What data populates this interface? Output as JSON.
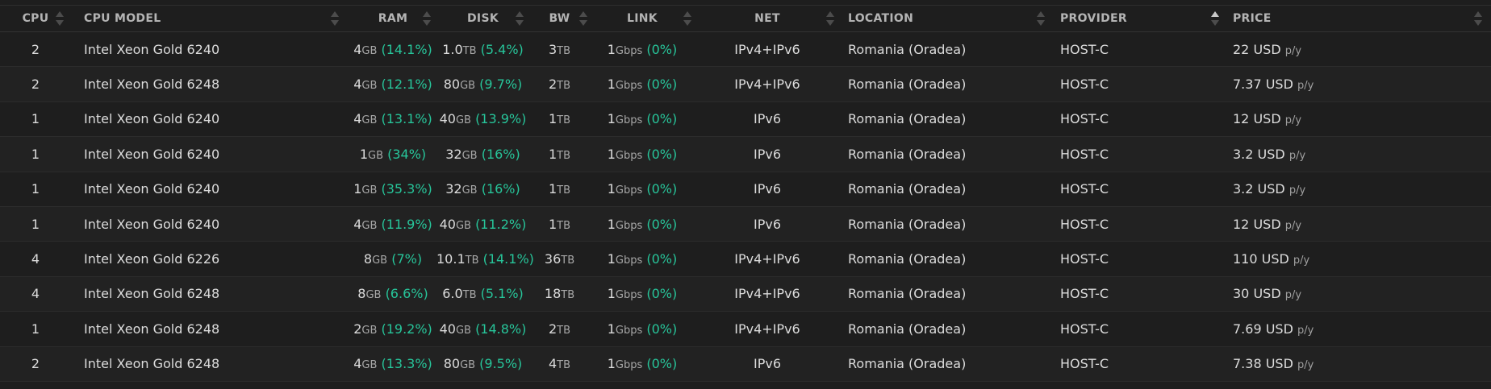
{
  "headers": {
    "cpu": "CPU",
    "cpu_model": "CPU MODEL",
    "ram": "RAM",
    "disk": "DISK",
    "bw": "BW",
    "link": "LINK",
    "net": "NET",
    "location": "LOCATION",
    "provider": "PROVIDER",
    "price": "PRICE"
  },
  "sorted_column": "provider",
  "colors": {
    "percent": "#27c59a",
    "background": "#1e1e1e",
    "alt_row": "#222222"
  },
  "rows": [
    {
      "cpu": "2",
      "model": "Intel Xeon Gold 6240",
      "ram": "4",
      "ram_unit": "GB",
      "ram_pct": "(14.1%)",
      "disk": "1.0",
      "disk_unit": "TB",
      "disk_pct": "(5.4%)",
      "bw": "3",
      "bw_unit": "TB",
      "link": "1",
      "link_unit": "Gbps",
      "link_pct": "(0%)",
      "net": "IPv4+IPv6",
      "location": "Romania (Oradea)",
      "provider": "HOST-C",
      "price": "22 USD",
      "price_unit": "p/y"
    },
    {
      "cpu": "2",
      "model": "Intel Xeon Gold 6248",
      "ram": "4",
      "ram_unit": "GB",
      "ram_pct": "(12.1%)",
      "disk": "80",
      "disk_unit": "GB",
      "disk_pct": "(9.7%)",
      "bw": "2",
      "bw_unit": "TB",
      "link": "1",
      "link_unit": "Gbps",
      "link_pct": "(0%)",
      "net": "IPv4+IPv6",
      "location": "Romania (Oradea)",
      "provider": "HOST-C",
      "price": "7.37 USD",
      "price_unit": "p/y"
    },
    {
      "cpu": "1",
      "model": "Intel Xeon Gold 6240",
      "ram": "4",
      "ram_unit": "GB",
      "ram_pct": "(13.1%)",
      "disk": "40",
      "disk_unit": "GB",
      "disk_pct": "(13.9%)",
      "bw": "1",
      "bw_unit": "TB",
      "link": "1",
      "link_unit": "Gbps",
      "link_pct": "(0%)",
      "net": "IPv6",
      "location": "Romania (Oradea)",
      "provider": "HOST-C",
      "price": "12 USD",
      "price_unit": "p/y"
    },
    {
      "cpu": "1",
      "model": "Intel Xeon Gold 6240",
      "ram": "1",
      "ram_unit": "GB",
      "ram_pct": "(34%)",
      "disk": "32",
      "disk_unit": "GB",
      "disk_pct": "(16%)",
      "bw": "1",
      "bw_unit": "TB",
      "link": "1",
      "link_unit": "Gbps",
      "link_pct": "(0%)",
      "net": "IPv6",
      "location": "Romania (Oradea)",
      "provider": "HOST-C",
      "price": "3.2 USD",
      "price_unit": "p/y"
    },
    {
      "cpu": "1",
      "model": "Intel Xeon Gold 6240",
      "ram": "1",
      "ram_unit": "GB",
      "ram_pct": "(35.3%)",
      "disk": "32",
      "disk_unit": "GB",
      "disk_pct": "(16%)",
      "bw": "1",
      "bw_unit": "TB",
      "link": "1",
      "link_unit": "Gbps",
      "link_pct": "(0%)",
      "net": "IPv6",
      "location": "Romania (Oradea)",
      "provider": "HOST-C",
      "price": "3.2 USD",
      "price_unit": "p/y"
    },
    {
      "cpu": "1",
      "model": "Intel Xeon Gold 6240",
      "ram": "4",
      "ram_unit": "GB",
      "ram_pct": "(11.9%)",
      "disk": "40",
      "disk_unit": "GB",
      "disk_pct": "(11.2%)",
      "bw": "1",
      "bw_unit": "TB",
      "link": "1",
      "link_unit": "Gbps",
      "link_pct": "(0%)",
      "net": "IPv6",
      "location": "Romania (Oradea)",
      "provider": "HOST-C",
      "price": "12 USD",
      "price_unit": "p/y"
    },
    {
      "cpu": "4",
      "model": "Intel Xeon Gold 6226",
      "ram": "8",
      "ram_unit": "GB",
      "ram_pct": "(7%)",
      "disk": "10.1",
      "disk_unit": "TB",
      "disk_pct": "(14.1%)",
      "bw": "36",
      "bw_unit": "TB",
      "link": "1",
      "link_unit": "Gbps",
      "link_pct": "(0%)",
      "net": "IPv4+IPv6",
      "location": "Romania (Oradea)",
      "provider": "HOST-C",
      "price": "110 USD",
      "price_unit": "p/y"
    },
    {
      "cpu": "4",
      "model": "Intel Xeon Gold 6248",
      "ram": "8",
      "ram_unit": "GB",
      "ram_pct": "(6.6%)",
      "disk": "6.0",
      "disk_unit": "TB",
      "disk_pct": "(5.1%)",
      "bw": "18",
      "bw_unit": "TB",
      "link": "1",
      "link_unit": "Gbps",
      "link_pct": "(0%)",
      "net": "IPv4+IPv6",
      "location": "Romania (Oradea)",
      "provider": "HOST-C",
      "price": "30 USD",
      "price_unit": "p/y"
    },
    {
      "cpu": "1",
      "model": "Intel Xeon Gold 6248",
      "ram": "2",
      "ram_unit": "GB",
      "ram_pct": "(19.2%)",
      "disk": "40",
      "disk_unit": "GB",
      "disk_pct": "(14.8%)",
      "bw": "2",
      "bw_unit": "TB",
      "link": "1",
      "link_unit": "Gbps",
      "link_pct": "(0%)",
      "net": "IPv4+IPv6",
      "location": "Romania (Oradea)",
      "provider": "HOST-C",
      "price": "7.69 USD",
      "price_unit": "p/y"
    },
    {
      "cpu": "2",
      "model": "Intel Xeon Gold 6248",
      "ram": "4",
      "ram_unit": "GB",
      "ram_pct": "(13.3%)",
      "disk": "80",
      "disk_unit": "GB",
      "disk_pct": "(9.5%)",
      "bw": "4",
      "bw_unit": "TB",
      "link": "1",
      "link_unit": "Gbps",
      "link_pct": "(0%)",
      "net": "IPv6",
      "location": "Romania (Oradea)",
      "provider": "HOST-C",
      "price": "7.38 USD",
      "price_unit": "p/y"
    }
  ]
}
